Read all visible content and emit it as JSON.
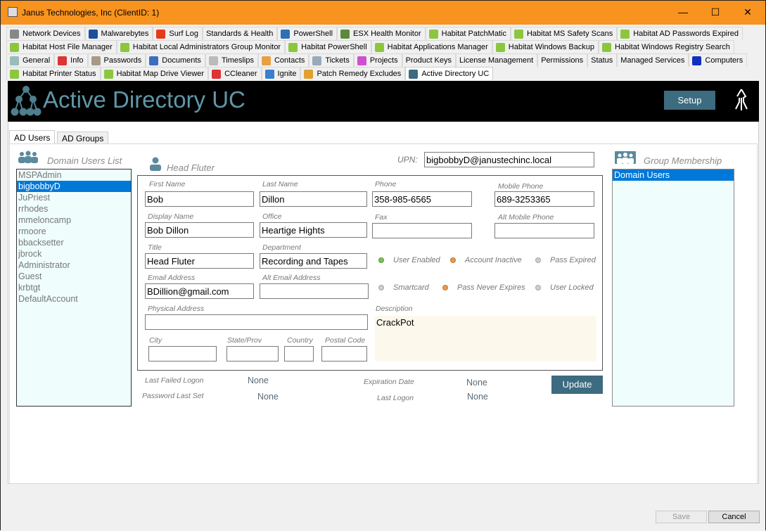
{
  "window": {
    "title": "Janus Technologies, Inc  (ClientID: 1)",
    "minimize": "—",
    "maximize": "☐",
    "close": "✕"
  },
  "tab_rows": [
    [
      {
        "label": "Network Devices",
        "icon": "network-device-icon",
        "color": "#888"
      },
      {
        "label": "Malwarebytes",
        "icon": "malwarebytes-icon",
        "color": "#1c4e9c"
      },
      {
        "label": "Surf Log",
        "icon": "flame-icon",
        "color": "#e63b1a"
      },
      {
        "label": "Standards & Health",
        "icon": "",
        "color": ""
      },
      {
        "label": "PowerShell",
        "icon": "powershell-icon",
        "color": "#2f6fb5"
      },
      {
        "label": "ESX Health Monitor",
        "icon": "esx-icon",
        "color": "#5a8a3a"
      },
      {
        "label": "Habitat PatchMatic",
        "icon": "house-icon",
        "color": "#8cc63f"
      },
      {
        "label": "Habitat MS Safety Scans",
        "icon": "house-icon",
        "color": "#8cc63f"
      },
      {
        "label": "Habitat AD Passwords Expired",
        "icon": "house-icon",
        "color": "#8cc63f"
      }
    ],
    [
      {
        "label": "Habitat Host File Manager",
        "icon": "house-icon",
        "color": "#8cc63f"
      },
      {
        "label": "Habitat Local Administrators Group Monitor",
        "icon": "house-icon",
        "color": "#8cc63f"
      },
      {
        "label": "Habitat PowerShell",
        "icon": "house-icon",
        "color": "#8cc63f"
      },
      {
        "label": "Habitat Applications Manager",
        "icon": "house-icon",
        "color": "#8cc63f"
      },
      {
        "label": "Habitat Windows Backup",
        "icon": "house-icon",
        "color": "#8cc63f"
      },
      {
        "label": "Habitat Windows Registry Search",
        "icon": "house-icon",
        "color": "#8cc63f"
      }
    ],
    [
      {
        "label": "General",
        "icon": "id-card-icon",
        "color": "#9bb"
      },
      {
        "label": "Info",
        "icon": "info-icon",
        "color": "#d33"
      },
      {
        "label": "Passwords",
        "icon": "keys-icon",
        "color": "#a98"
      },
      {
        "label": "Documents",
        "icon": "documents-icon",
        "color": "#3a6fc0"
      },
      {
        "label": "Timeslips",
        "icon": "clock-icon",
        "color": "#bbb"
      },
      {
        "label": "Contacts",
        "icon": "contacts-icon",
        "color": "#e9a040"
      },
      {
        "label": "Tickets",
        "icon": "tickets-icon",
        "color": "#9ab"
      },
      {
        "label": "Projects",
        "icon": "projects-icon",
        "color": "#d04fd0"
      },
      {
        "label": "Product Keys",
        "icon": "",
        "color": ""
      },
      {
        "label": "License Management",
        "icon": "",
        "color": ""
      },
      {
        "label": "Permissions",
        "icon": "",
        "color": ""
      },
      {
        "label": "Status",
        "icon": "",
        "color": ""
      },
      {
        "label": "Managed Services",
        "icon": "",
        "color": ""
      },
      {
        "label": "Computers",
        "icon": "computer-icon",
        "color": "#1030c0"
      }
    ],
    [
      {
        "label": "Habitat Printer Status",
        "icon": "house-icon",
        "color": "#8cc63f"
      },
      {
        "label": "Habitat Map Drive Viewer",
        "icon": "house-icon",
        "color": "#8cc63f"
      },
      {
        "label": "CCleaner",
        "icon": "ccleaner-icon",
        "color": "#d33"
      },
      {
        "label": "Ignite",
        "icon": "ignite-icon",
        "color": "#3a7fd0"
      },
      {
        "label": "Patch Remedy Excludes",
        "icon": "patch-icon",
        "color": "#e0a030"
      },
      {
        "label": "Active Directory UC",
        "icon": "ad-tree-icon",
        "color": "#3d6b7f",
        "active": true
      }
    ]
  ],
  "header": {
    "title": "Active Directory UC",
    "setup": "Setup"
  },
  "subtabs": {
    "users": "AD Users",
    "groups": "AD Groups"
  },
  "users": {
    "title": "Domain Users List",
    "items": [
      "MSPAdmin",
      "bigbobbyD",
      "JuPriest",
      "rrhodes",
      "mmeloncamp",
      "rmoore",
      "bbacksetter",
      "jbrock",
      "Administrator",
      "Guest",
      "krbtgt",
      "DefaultAccount"
    ],
    "selected": "bigbobbyD"
  },
  "personal": {
    "title": "Head Fluter",
    "upn_label": "UPN:",
    "upn": "bigbobbyD@janustechinc.local",
    "first_name_label": "First Name",
    "first_name": "Bob",
    "last_name_label": "Last Name",
    "last_name": "Dillon",
    "phone_label": "Phone",
    "phone": "358-985-6565",
    "mobile_label": "Mobile Phone",
    "mobile": "689-3253365",
    "display_name_label": "Display Name",
    "display_name": "Bob Dillon",
    "office_label": "Office",
    "office": "Heartige Hights",
    "fax_label": "Fax",
    "fax": "",
    "alt_mobile_label": "Alt Mobile Phone",
    "alt_mobile": "",
    "title_label": "Title",
    "department_label": "Department",
    "department": "Recording and Tapes",
    "email_label": "Email Address",
    "email": "BDillion@gmail.com",
    "alt_email_label": "Alt Email Address",
    "alt_email": "",
    "address_label": "Physical Address",
    "address": "",
    "city_label": "City",
    "city": "",
    "state_label": "State/Prov",
    "state": "",
    "country_label": "Country",
    "country": "",
    "postal_label": "Postal Code",
    "postal": "",
    "description_label": "Description",
    "description": "CrackPot"
  },
  "flags": [
    {
      "label": "User Enabled",
      "color": "#7cc24a"
    },
    {
      "label": "Account Inactive",
      "color": "#e89a4a"
    },
    {
      "label": "Pass Expired",
      "color": "#cfcfcf"
    },
    {
      "label": "Smartcard",
      "color": "#cfcfcf"
    },
    {
      "label": "Pass Never Expires",
      "color": "#e89a4a"
    },
    {
      "label": "User Locked",
      "color": "#cfcfcf"
    }
  ],
  "logon": {
    "last_failed_label": "Last Failed Logon",
    "last_failed": "None",
    "pwd_last_set_label": "Password Last Set",
    "pwd_last_set": "None",
    "expiration_label": "Expiration Date",
    "expiration": "None",
    "last_logon_label": "Last Logon",
    "last_logon": "None",
    "update": "Update"
  },
  "groups": {
    "title": "Group Membership",
    "items": [
      "Domain Users"
    ],
    "selected": "Domain Users"
  },
  "footer": {
    "save": "Save",
    "cancel": "Cancel"
  },
  "colors": {
    "accent": "#3d6b7f",
    "titlebar": "#f7931e",
    "selection": "#0078d7"
  }
}
